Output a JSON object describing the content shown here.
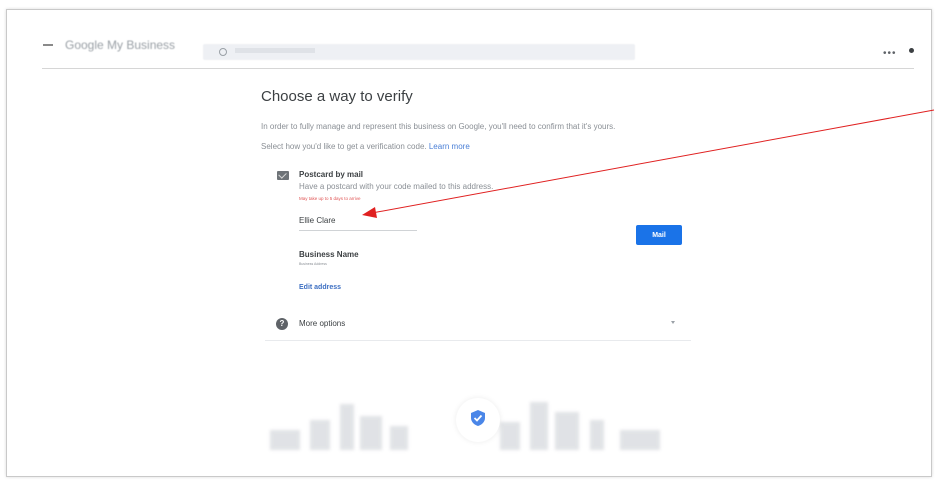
{
  "header": {
    "logo_text": "Google My Business",
    "search_placeholder": ""
  },
  "main": {
    "title": "Choose a way to verify",
    "intro": "In order to fully manage and represent this business on Google, you'll need to confirm that it's yours.",
    "select_prompt": "Select how you'd like to get a verification code.",
    "learn_more": "Learn more"
  },
  "method": {
    "icon": "mail-icon",
    "title": "Postcard by mail",
    "description": "Have a postcard with your code mailed to this address.",
    "delay_note": "May take up to 5 days to arrive",
    "name_value": "Ellie Clare",
    "mail_button": "Mail",
    "business_name": "Business Name",
    "business_address": "Business Address",
    "edit_address": "Edit address"
  },
  "more_options": {
    "label": "More options"
  },
  "colors": {
    "accent": "#1a73e8",
    "link": "#3d6fc2",
    "annotation_arrow": "#e02020"
  }
}
